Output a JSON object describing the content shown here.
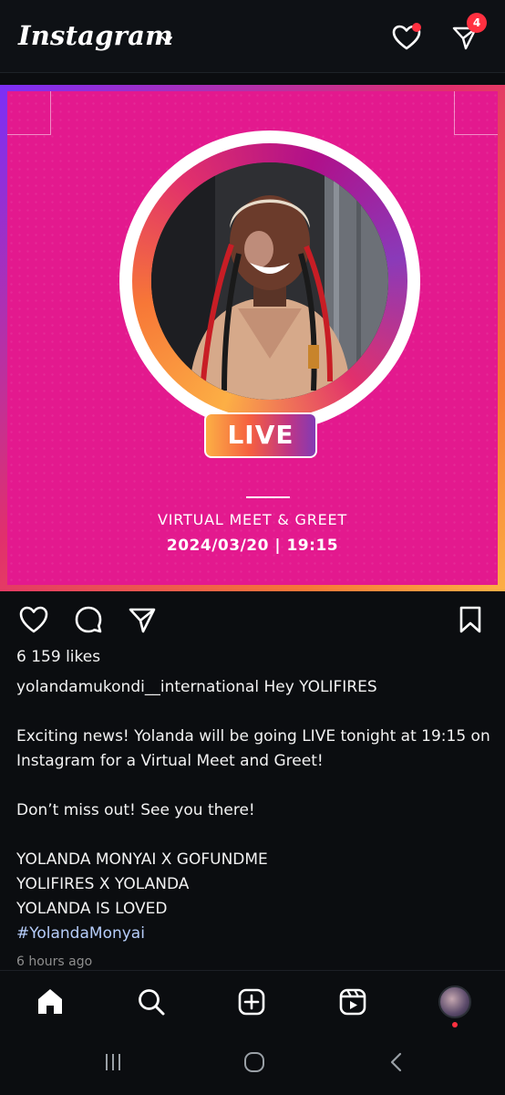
{
  "header": {
    "app_name": "Instagram",
    "dm_badge_count": "4"
  },
  "post": {
    "live_label": "LIVE",
    "event_title": "VIRTUAL MEET & GREET",
    "event_datetime": "2024/03/20 | 19:15",
    "likes": "6 159 likes",
    "caption": {
      "username": "yolandamukondi__international",
      "first_line_text": "Hey YOLIFIRES",
      "line_2": "Exciting news! Yolanda will be going LIVE tonight at 19:15 on Instagram for a Virtual Meet and Greet!",
      "line_3": "Don’t miss out! See you there!",
      "line_4": "YOLANDA MONYAI X GOFUNDME",
      "line_5": "YOLIFIRES X YOLANDA",
      "line_6": "YOLANDA IS LOVED",
      "hashtag": "#YolandaMonyai"
    },
    "time_ago": "6 hours ago"
  },
  "colors": {
    "accent_pink": "#e3198e",
    "notification_red": "#ff3040",
    "hashtag_blue": "#b6cdfa",
    "background": "#0b0d10"
  },
  "icons": {
    "top": [
      "heart-icon",
      "direct-message-icon"
    ],
    "actions": [
      "like-heart-icon",
      "comment-icon",
      "share-icon",
      "save-bookmark-icon"
    ],
    "bottom_nav": [
      "home-icon",
      "search-icon",
      "create-plus-icon",
      "reels-icon",
      "profile-avatar"
    ],
    "system": [
      "recent-apps-icon",
      "home-circle-icon",
      "back-chevron-icon"
    ]
  }
}
